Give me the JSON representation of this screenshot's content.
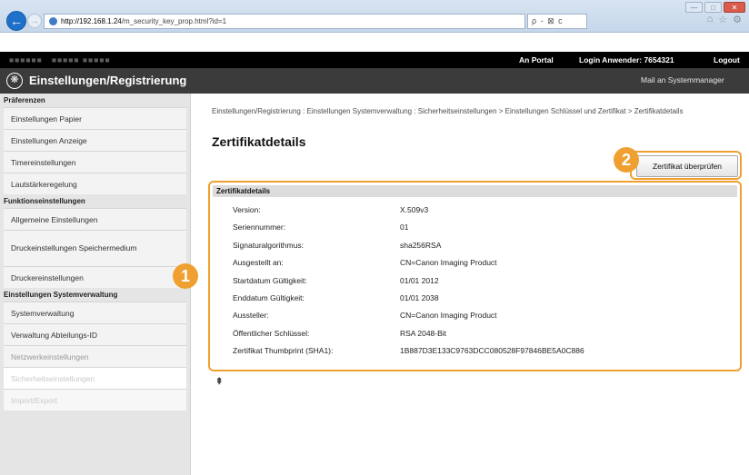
{
  "browser": {
    "window_buttons": [
      "—",
      "□",
      "✕"
    ],
    "url_host": "http://192.168.1.24",
    "url_path": "/m_security_key_prop.html?id=1",
    "addr_tools": "ρ - ⊠ c",
    "icons": [
      "home-icon",
      "star-icon",
      "gear-icon"
    ]
  },
  "header": {
    "portal": "An Portal",
    "login_label": "Login Anwender:  7654321",
    "logout": "Logout",
    "title": "Einstellungen/Registrierung",
    "mail": "Mail an Systemmanager"
  },
  "sidebar": {
    "sections": [
      {
        "category": "Präferenzen",
        "items": [
          "Einstellungen Papier",
          "Einstellungen Anzeige",
          "Timereinstellungen",
          "Lautstärkeregelung"
        ]
      },
      {
        "category": "Funktionseinstellungen",
        "items": [
          "Allgemeine Einstellungen",
          "Druckeinstellungen Speichermedium",
          "Druckereinstellungen"
        ]
      },
      {
        "category": "Einstellungen Systemverwaltung",
        "items": [
          "Systemverwaltung",
          "Verwaltung Abteilungs-ID",
          "Netzwerkeinstellungen",
          "Sicherheitseinstellungen",
          "Import/Export"
        ]
      }
    ]
  },
  "main": {
    "breadcrumb": "Einstellungen/Registrierung : Einstellungen Systemverwaltung : Sicherheitseinstellungen > Einstellungen Schlüssel und Zertifikat > Zertifikatdetails",
    "page_title": "Zertifikatdetails",
    "check_button": "Zertifikat überprüfen",
    "panel_title": "Zertifikatdetails",
    "details": [
      {
        "label": "Version:",
        "value": "X.509v3"
      },
      {
        "label": "Seriennummer:",
        "value": "01"
      },
      {
        "label": "Signaturalgorithmus:",
        "value": "sha256RSA"
      },
      {
        "label": "Ausgestellt an:",
        "value": "CN=Canon Imaging Product"
      },
      {
        "label": "Startdatum Gültigkeit:",
        "value": "01/01 2012"
      },
      {
        "label": "Enddatum Gültigkeit:",
        "value": "01/01 2038"
      },
      {
        "label": "Aussteller:",
        "value": "CN=Canon Imaging Product"
      },
      {
        "label": "Öffentlicher Schlüssel:",
        "value": "RSA 2048-Bit"
      },
      {
        "label": "Zertifikat Thumbprint (SHA1):",
        "value": "1B887D3E133C9763DCC080528F97846BE5A0C886"
      }
    ],
    "top_link": "⇞",
    "callouts": [
      "1",
      "2"
    ]
  },
  "colors": {
    "accent": "#f0a030",
    "title_bar": "#3b3b3b",
    "top_bar": "#000000",
    "sidebar_bg": "#e5e5e5"
  }
}
